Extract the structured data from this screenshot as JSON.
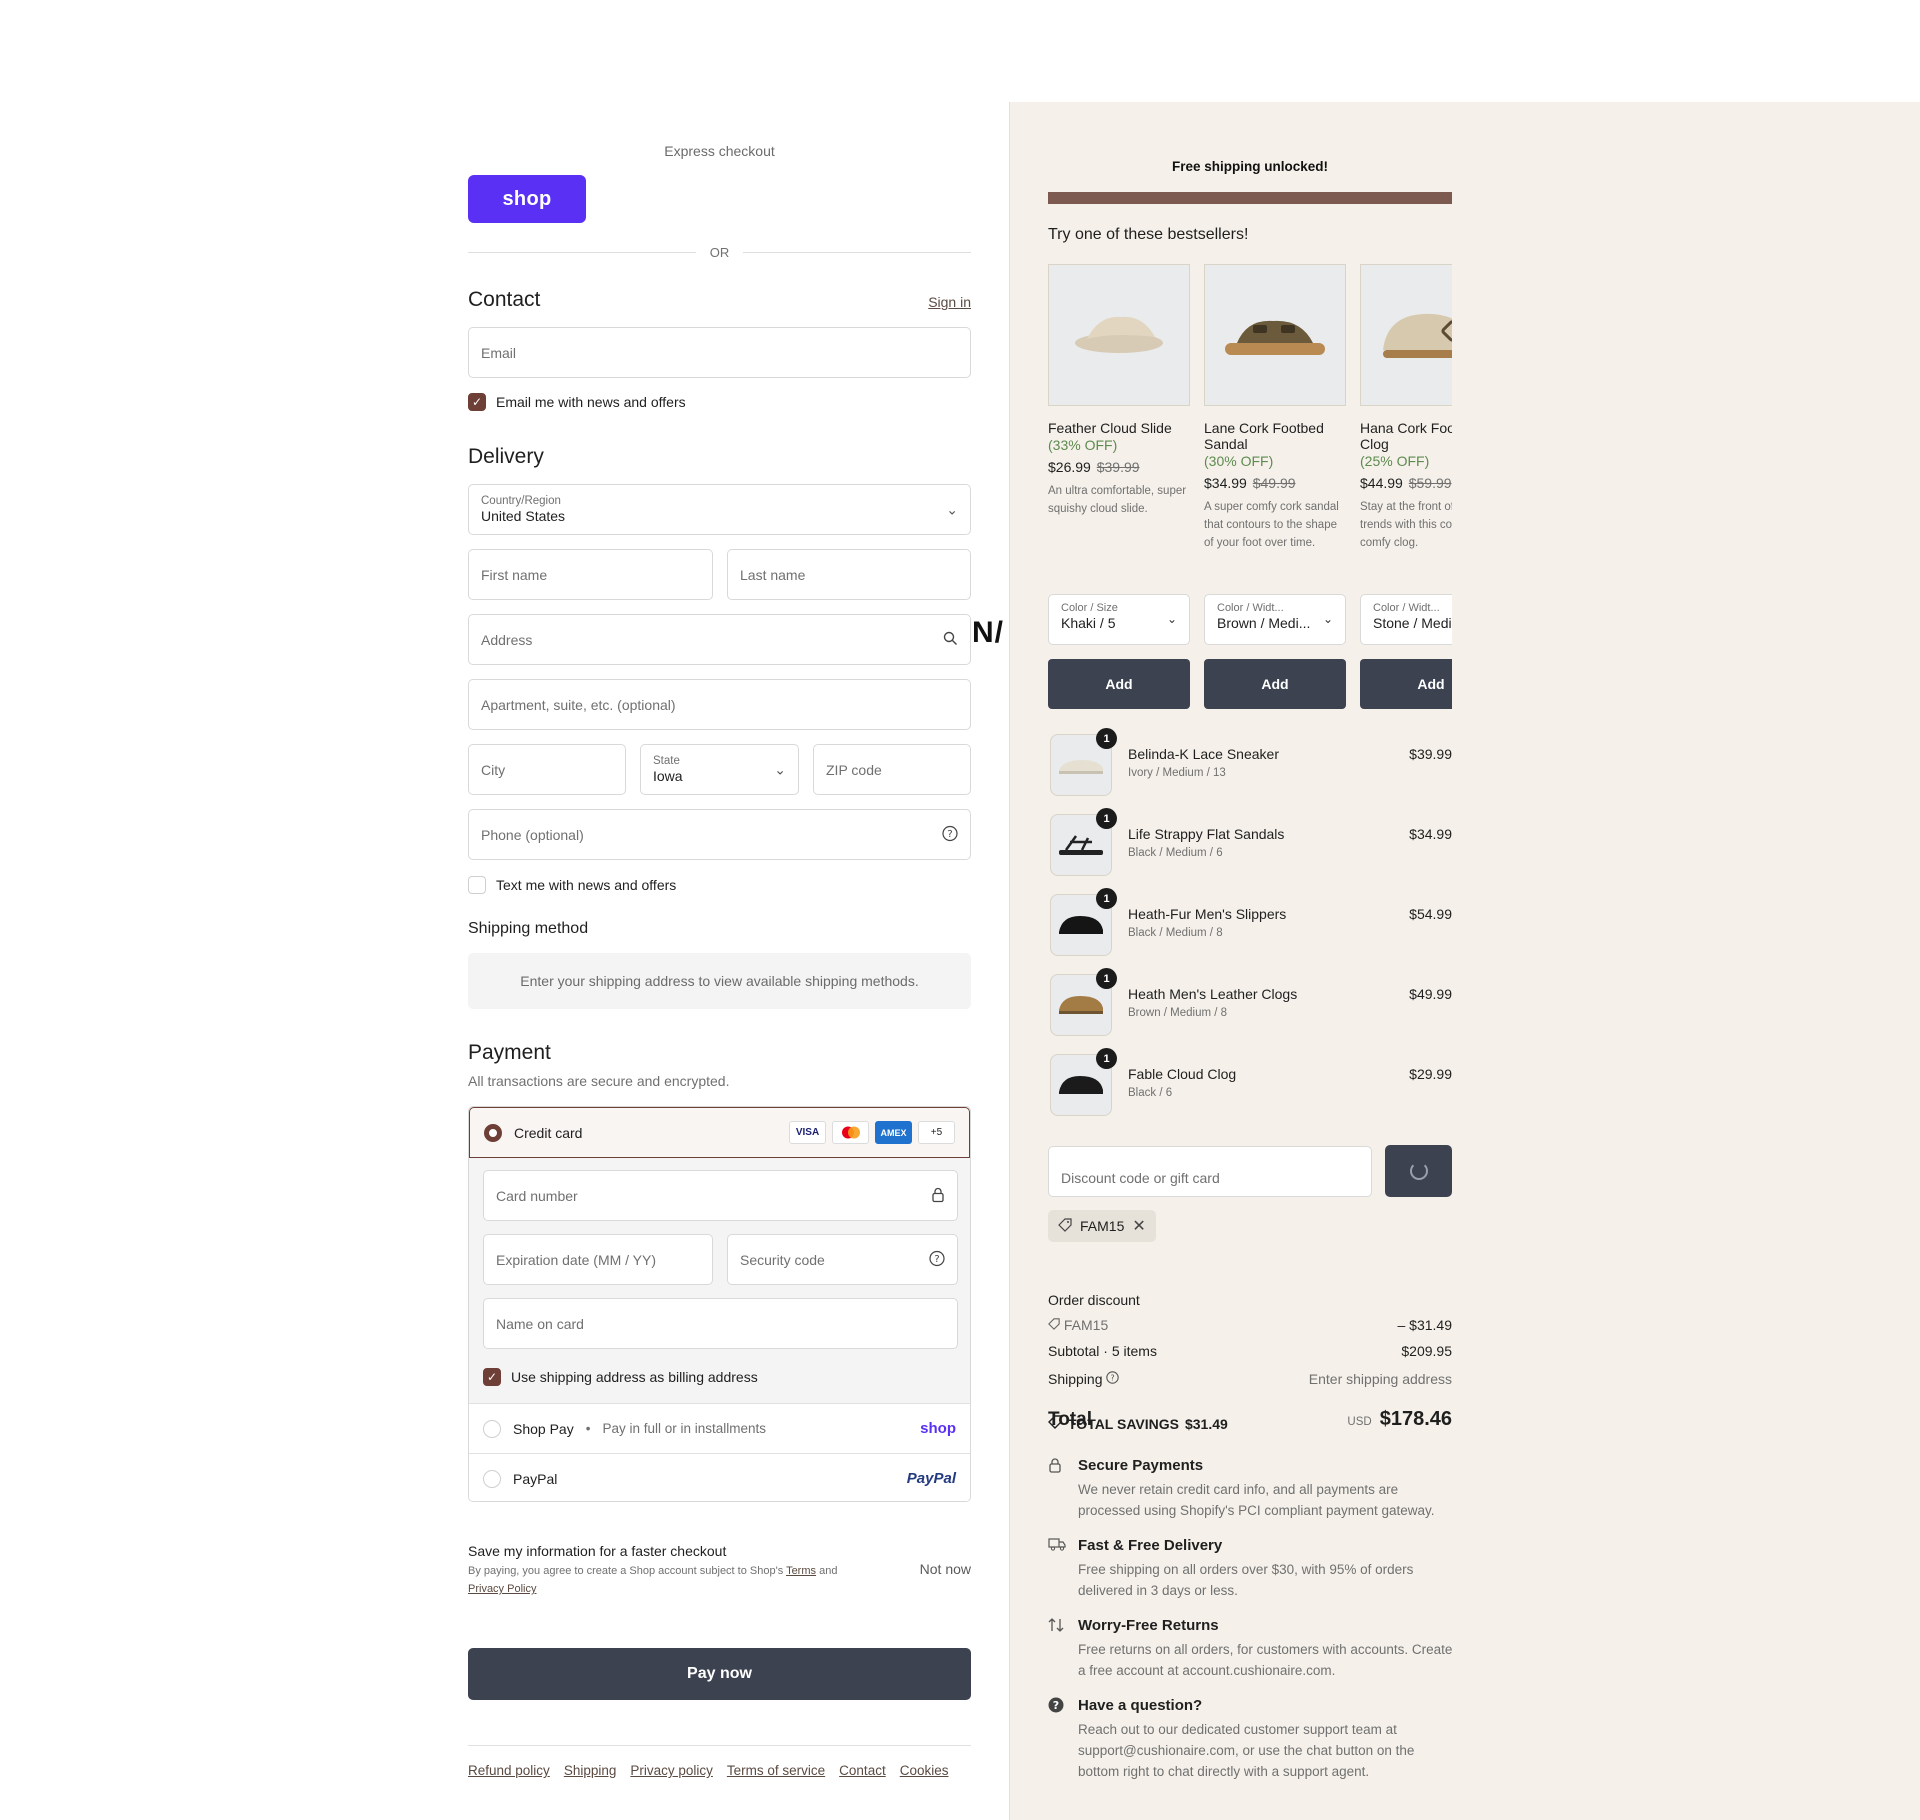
{
  "colors": {
    "brand": "#6e3f36",
    "shop_purple": "#5a31f4",
    "button_dark": "#3c4250",
    "summary_bg": "#f5f1ea",
    "discount_green": "#5d8a4e"
  },
  "express": {
    "label": "Express checkout",
    "shop_button": "shop",
    "or": "OR"
  },
  "contact": {
    "title": "Contact",
    "sign_in": "Sign in",
    "email_placeholder": "Email",
    "email_opt_in": "Email me with news and offers",
    "email_opt_in_checked": true
  },
  "delivery": {
    "title": "Delivery",
    "country_label": "Country/Region",
    "country_value": "United States",
    "first_name": "First name",
    "last_name": "Last name",
    "address": "Address",
    "apartment": "Apartment, suite, etc. (optional)",
    "city": "City",
    "state_label": "State",
    "state_value": "Iowa",
    "zip": "ZIP code",
    "phone": "Phone (optional)",
    "text_opt_in": "Text me with news and offers",
    "text_opt_in_checked": false
  },
  "overlap_text": "N/",
  "shipping_method": {
    "title": "Shipping method",
    "message": "Enter your shipping address to view available shipping methods."
  },
  "payment": {
    "title": "Payment",
    "subtitle": "All transactions are secure and encrypted.",
    "credit_card": "Credit card",
    "card_logos": [
      "VISA",
      "MC",
      "AMEX",
      "+5"
    ],
    "card_number": "Card number",
    "expiration": "Expiration date (MM / YY)",
    "security_code": "Security code",
    "name_on_card": "Name on card",
    "use_shipping": "Use shipping address as billing address",
    "use_shipping_checked": true,
    "shop_pay": "Shop Pay",
    "shop_pay_sub": "Pay in full or in installments",
    "shop_pay_brand": "shop",
    "paypal": "PayPal",
    "paypal_brand": "PayPal"
  },
  "save_info": {
    "title": "Save my information for a faster checkout",
    "terms_pre": "By paying, you agree to create a Shop account subject to Shop's",
    "terms_link": "Terms",
    "terms_and": "and",
    "privacy_link": "Privacy Policy",
    "not_now": "Not now"
  },
  "pay_now": "Pay now",
  "footer_links": [
    "Refund policy",
    "Shipping",
    "Privacy policy",
    "Terms of service",
    "Contact",
    "Cookies"
  ],
  "summary": {
    "free_shipping": "Free shipping unlocked!",
    "free_shipping_progress": 1.0,
    "try_title": "Try one of these bestsellers!",
    "bestsellers": [
      {
        "name": "Feather Cloud Slide",
        "off": "(33% OFF)",
        "price": "$26.99",
        "was": "$39.99",
        "desc": "An ultra comfortable, super squishy cloud slide.",
        "select_label": "Color / Size",
        "select_value": "Khaki / 5",
        "add": "Add"
      },
      {
        "name": "Lane Cork Footbed Sandal",
        "off": "(30% OFF)",
        "price": "$34.99",
        "was": "$49.99",
        "desc": "A super comfy cork sandal that contours to the shape of your foot over time.",
        "select_label": "Color / Widt...",
        "select_value": "Brown / Medi...",
        "add": "Add"
      },
      {
        "name": "Hana Cork Footbed Clog",
        "off": "(25% OFF)",
        "price": "$44.99",
        "was": "$59.99",
        "desc": "Stay at the front of fashion trends with this cool and comfy clog.",
        "select_label": "Color / Widt...",
        "select_value": "Stone / Medium",
        "add": "Add"
      }
    ],
    "items": [
      {
        "qty": "1",
        "name": "Belinda-K Lace Sneaker",
        "variant": "Ivory / Medium / 13",
        "price": "$39.99"
      },
      {
        "qty": "1",
        "name": "Life Strappy Flat Sandals",
        "variant": "Black / Medium / 6",
        "price": "$34.99"
      },
      {
        "qty": "1",
        "name": "Heath-Fur Men's Slippers",
        "variant": "Black / Medium / 8",
        "price": "$54.99"
      },
      {
        "qty": "1",
        "name": "Heath Men's Leather Clogs",
        "variant": "Brown / Medium / 8",
        "price": "$49.99"
      },
      {
        "qty": "1",
        "name": "Fable Cloud Clog",
        "variant": "Black / 6",
        "price": "$29.99"
      }
    ],
    "discount_placeholder": "Discount code or gift card",
    "applied_code": "FAM15",
    "order_discount_label": "Order discount",
    "order_discount_code": "FAM15",
    "order_discount_value": "– $31.49",
    "subtotal_label": "Subtotal · 5 items",
    "subtotal_value": "$209.95",
    "shipping_label": "Shipping",
    "shipping_value": "Enter shipping address",
    "total_label": "Total",
    "total_savings_label": "TOTAL SAVINGS",
    "total_savings_value": "$31.49",
    "currency": "USD",
    "total_value": "$178.46"
  },
  "benefits": [
    {
      "icon": "lock-icon",
      "title": "Secure Payments",
      "desc": "We never retain credit card info, and all payments are processed using Shopify's PCI compliant payment gateway."
    },
    {
      "icon": "truck-icon",
      "title": "Fast & Free Delivery",
      "desc": "Free shipping on all orders over $30, with 95% of orders delivered in 3 days or less."
    },
    {
      "icon": "returns-icon",
      "title": "Worry-Free Returns",
      "desc": "Free returns on all orders, for customers with accounts. Create a free account at account.cushionaire.com."
    },
    {
      "icon": "question-icon",
      "title": "Have a question?",
      "desc": "Reach out to our dedicated customer support team at support@cushionaire.com, or use the chat button on the bottom right to chat directly with a support agent."
    }
  ]
}
